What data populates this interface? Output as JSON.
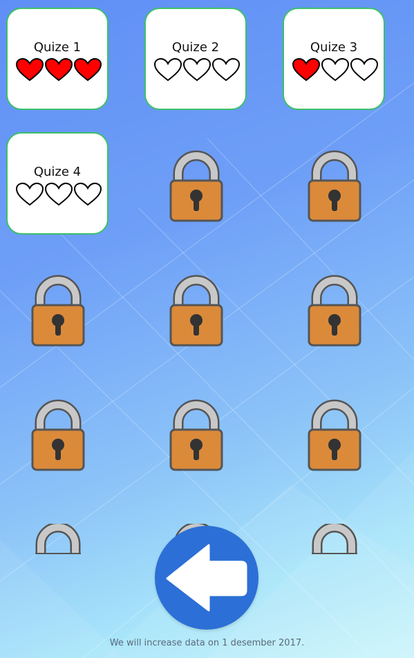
{
  "quizzes": [
    {
      "label": "Quize 1",
      "hearts_filled": 3,
      "hearts_total": 3
    },
    {
      "label": "Quize 2",
      "hearts_filled": 0,
      "hearts_total": 3
    },
    {
      "label": "Quize 3",
      "hearts_filled": 1,
      "hearts_total": 3
    },
    {
      "label": "Quize 4",
      "hearts_filled": 0,
      "hearts_total": 3
    }
  ],
  "colors": {
    "heart_filled": "#ff0000",
    "heart_empty": "#ffffff",
    "card_border": "#3cc06a",
    "lock_body": "#db8a3a",
    "lock_shackle": "#c8c8c8",
    "back_button": "#2c6fd6"
  },
  "icons": {
    "locked_level": "padlock-icon",
    "back": "back-arrow-icon",
    "heart": "heart-icon"
  },
  "footer": {
    "note": "We will increase data on 1 desember 2017."
  }
}
